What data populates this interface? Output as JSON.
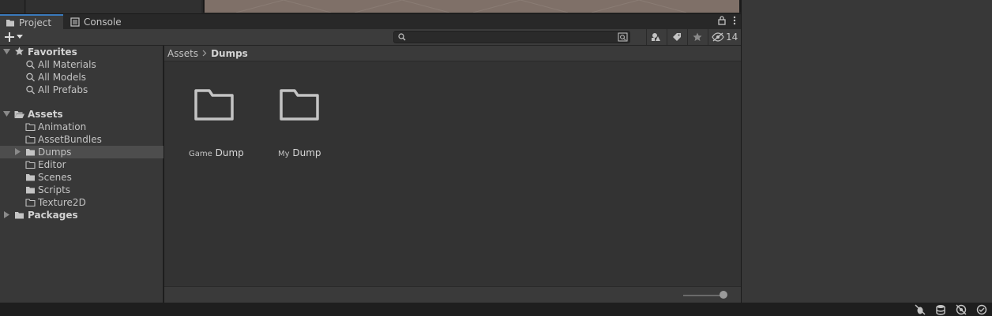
{
  "tabs": [
    {
      "label": "Project",
      "icon": "folder-icon",
      "active": true
    },
    {
      "label": "Console",
      "icon": "console-icon",
      "active": false
    }
  ],
  "toolbar": {
    "search_placeholder": "",
    "hidden_count": "14"
  },
  "favorites": {
    "label": "Favorites",
    "items": [
      "All Materials",
      "All Models",
      "All Prefabs"
    ]
  },
  "assets": {
    "label": "Assets",
    "items": [
      "Animation",
      "AssetBundles",
      "Dumps",
      "Editor",
      "Scenes",
      "Scripts",
      "Texture2D"
    ],
    "selected": "Dumps"
  },
  "packages": {
    "label": "Packages"
  },
  "breadcrumb": {
    "root": "Assets",
    "current": "Dumps"
  },
  "grid_items": [
    {
      "prefix": "Game",
      "name": "Dump"
    },
    {
      "prefix": "My",
      "name": "Dump"
    }
  ],
  "colors": {
    "accent": "#3a79bb",
    "panel": "#383838",
    "content": "#333333"
  }
}
